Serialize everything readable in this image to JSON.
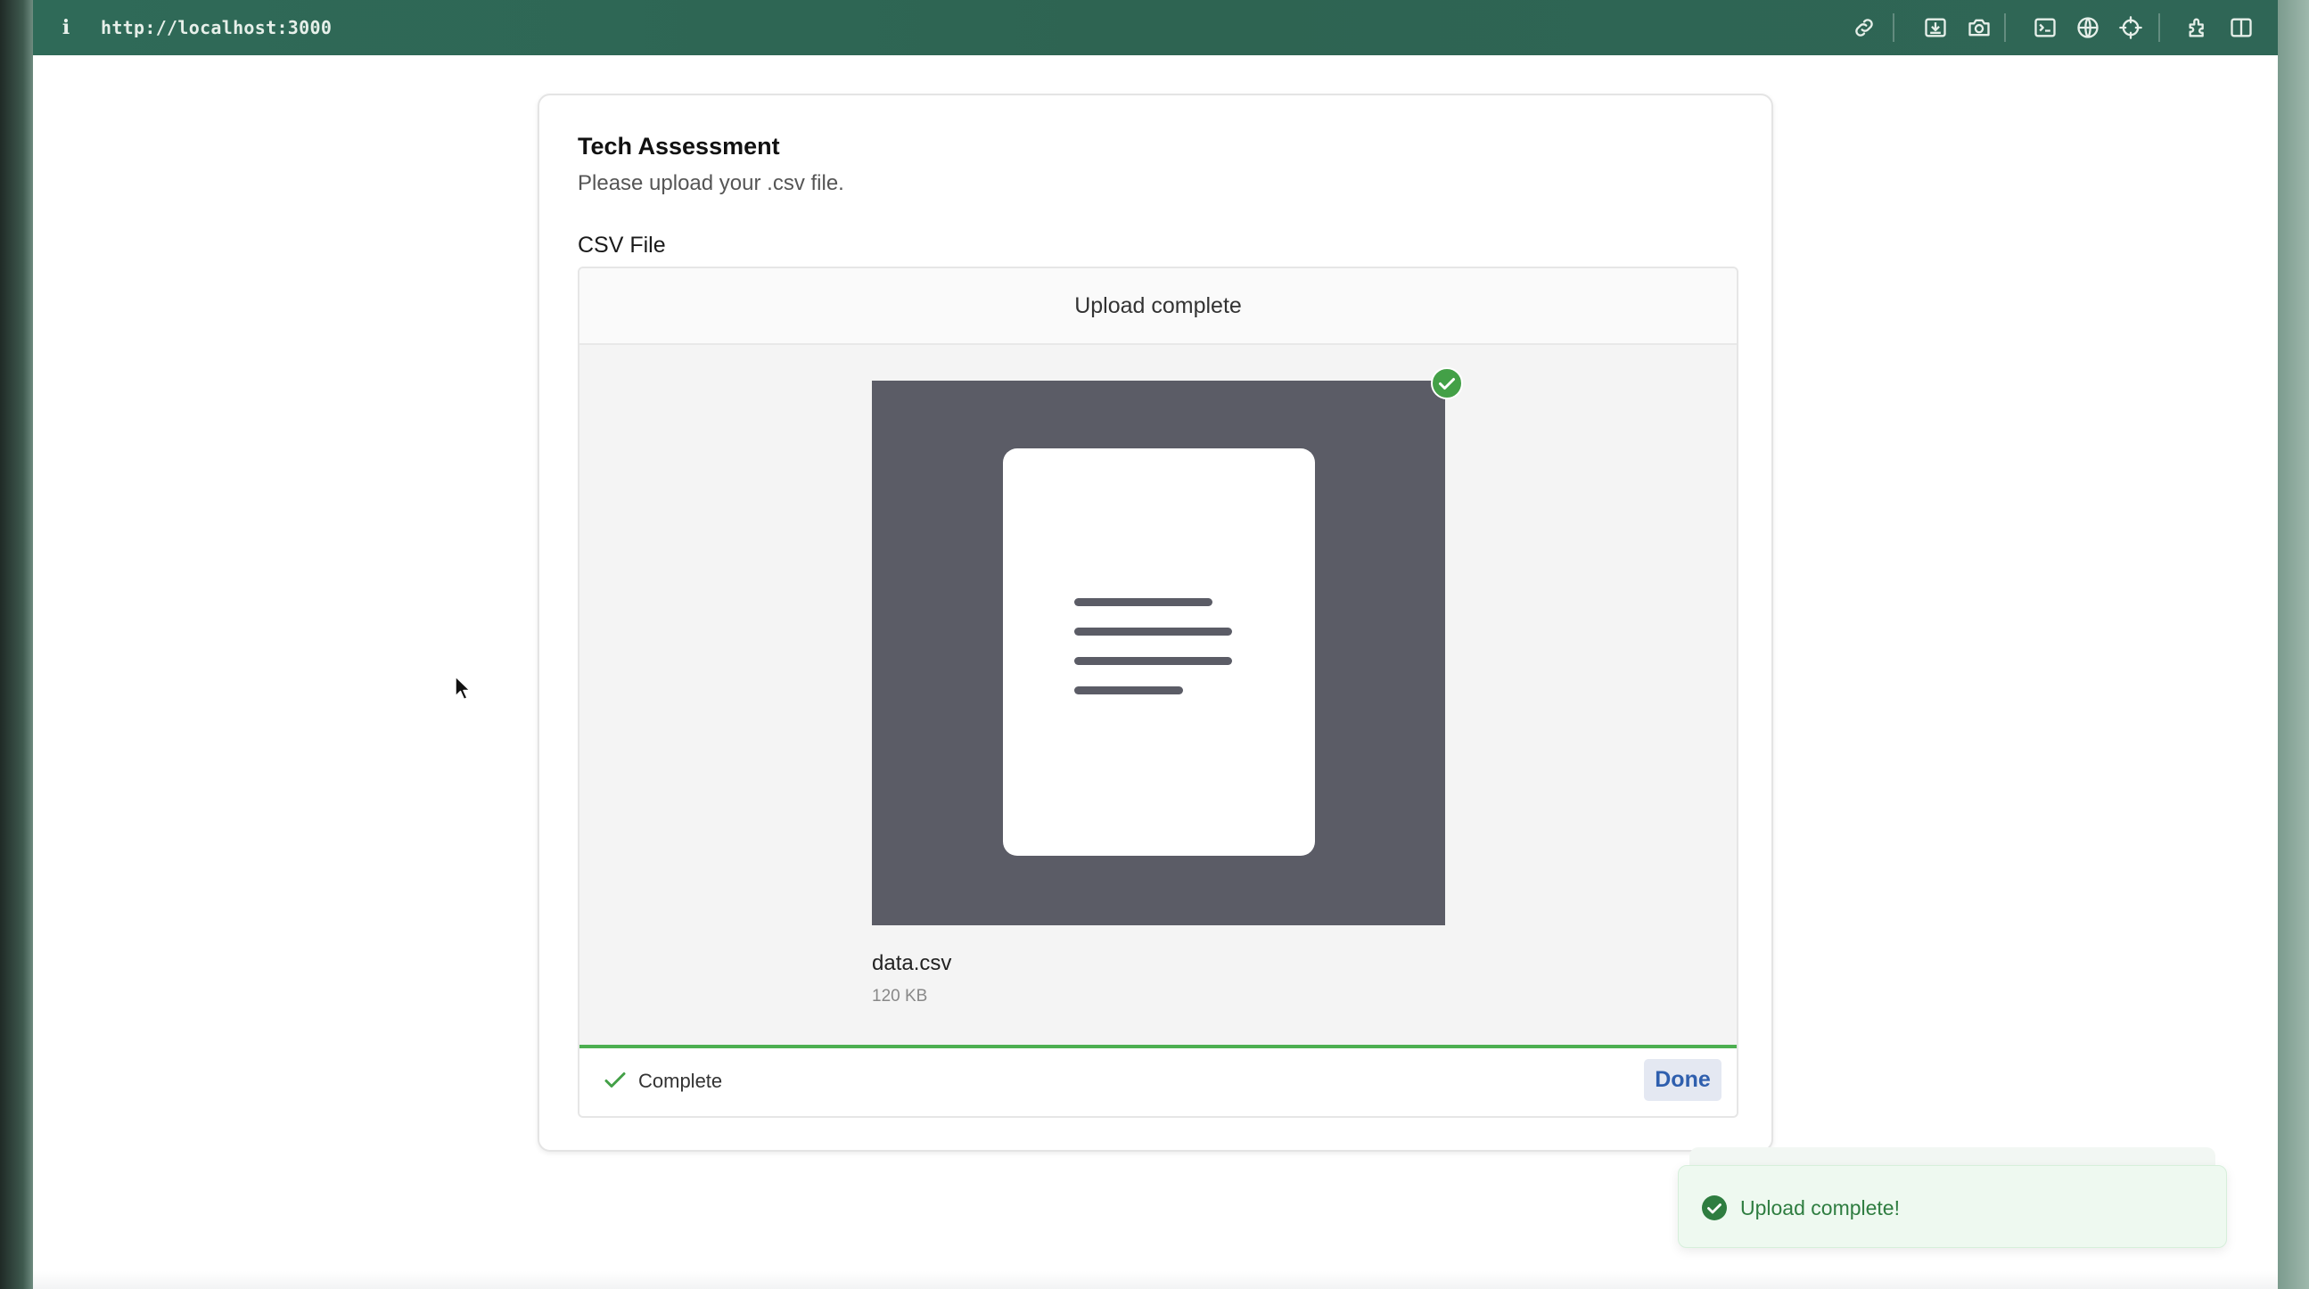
{
  "browser": {
    "url": "http://localhost:3000",
    "toolbar_icons": [
      "link-icon",
      "download-icon",
      "camera-icon",
      "terminal-icon",
      "globe-icon",
      "crosshair-icon",
      "extensions-icon",
      "split-view-icon"
    ]
  },
  "card": {
    "title": "Tech Assessment",
    "description": "Please upload your .csv file.",
    "field_label": "CSV File"
  },
  "uploader": {
    "header": "Upload complete",
    "file": {
      "name": "data.csv",
      "size": "120 KB"
    },
    "status": "Complete",
    "done_label": "Done",
    "progress_fraction": 1.0,
    "accent_color": "#4caf50"
  },
  "toast": {
    "message": "Upload complete!",
    "color": "#2e7d40"
  }
}
